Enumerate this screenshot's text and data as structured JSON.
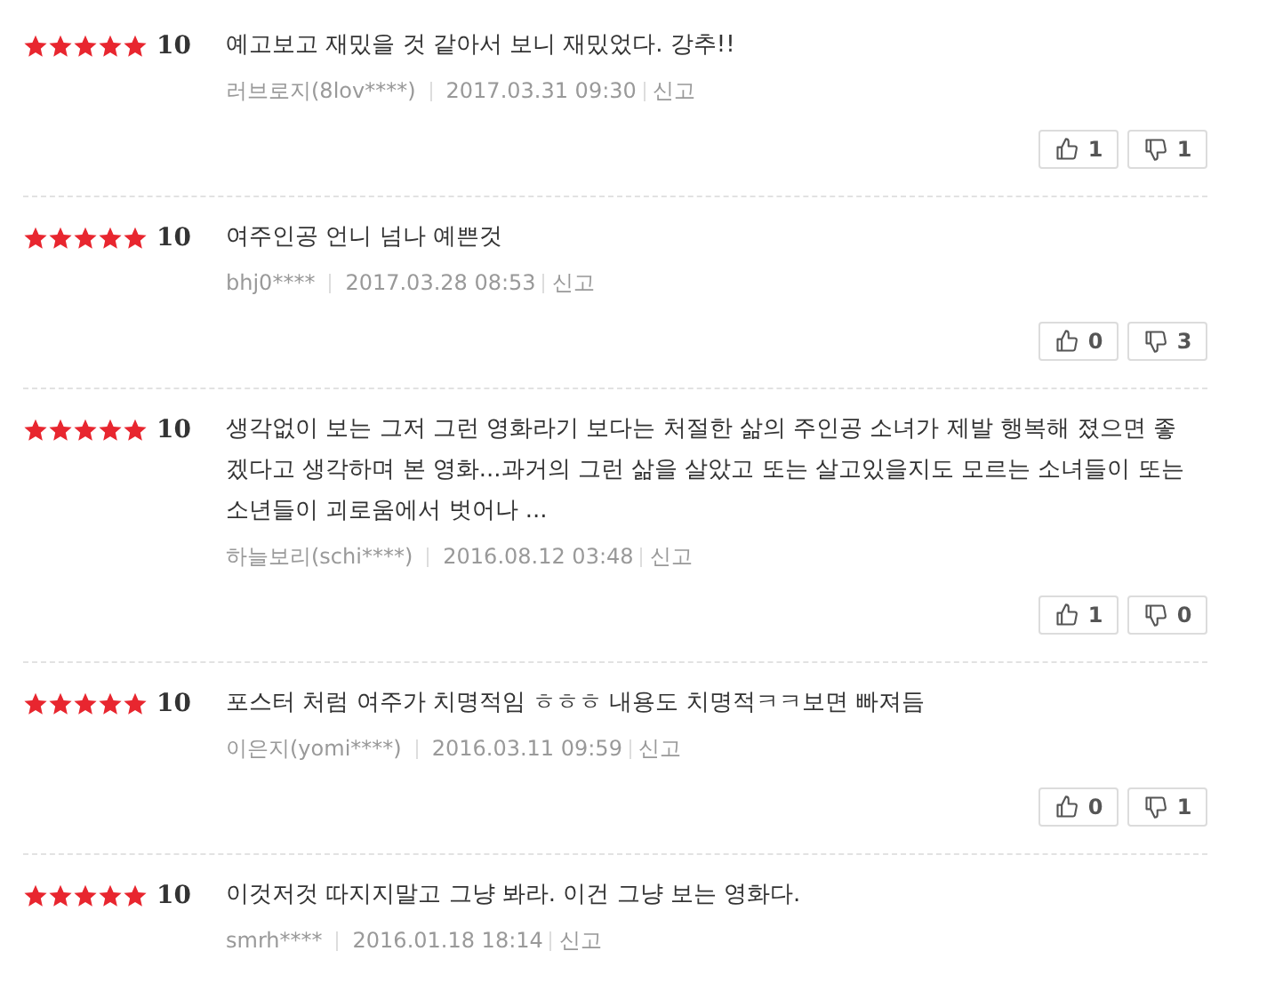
{
  "reviews": [
    {
      "stars": 5,
      "score": "10",
      "text": "예고보고 재밌을 것 같아서 보니 재밌었다. 강추!!",
      "author": "러브로지(8lov****)",
      "date": "2017.03.31 09:30",
      "report": "신고",
      "likes": "1",
      "dislikes": "1"
    },
    {
      "stars": 5,
      "score": "10",
      "text": "여주인공 언니 넘나 예쁜것",
      "author": "bhj0****",
      "date": "2017.03.28 08:53",
      "report": "신고",
      "likes": "0",
      "dislikes": "3"
    },
    {
      "stars": 5,
      "score": "10",
      "text": "생각없이 보는 그저 그런 영화라기 보다는 처절한 삶의 주인공 소녀가 제발 행복해 졌으면 좋겠다고 생각하며 본 영화...과거의 그런 삶을 살았고 또는 살고있을지도 모르는 소녀들이 또는 소년들이 괴로움에서 벗어나 ...",
      "author": "하늘보리(schi****)",
      "date": "2016.08.12 03:48",
      "report": "신고",
      "likes": "1",
      "dislikes": "0"
    },
    {
      "stars": 5,
      "score": "10",
      "text": "포스터 처럼 여주가 치명적임 ㅎㅎㅎ 내용도 치명적ㅋㅋ보면 빠져듬",
      "author": "이은지(yomi****)",
      "date": "2016.03.11 09:59",
      "report": "신고",
      "likes": "0",
      "dislikes": "1"
    },
    {
      "stars": 5,
      "score": "10",
      "text": "이것저것 따지지말고 그냥 봐라. 이건 그냥 보는 영화다.",
      "author": "smrh****",
      "date": "2016.01.18 18:14",
      "report": "신고"
    }
  ]
}
